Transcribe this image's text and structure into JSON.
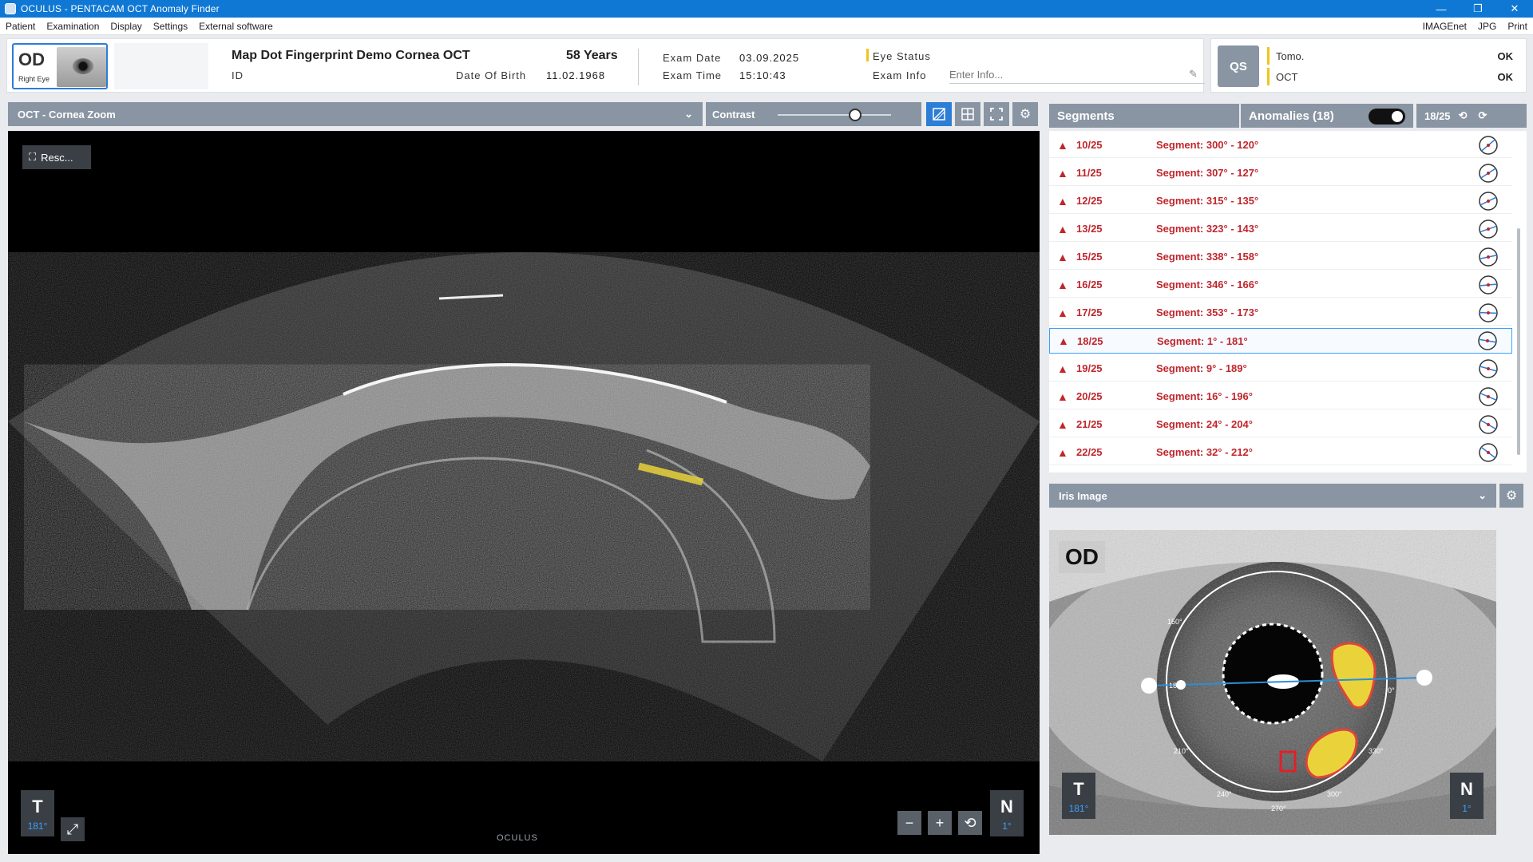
{
  "window": {
    "title": "OCULUS  -  PENTACAM   OCT Anomaly Finder",
    "minimize": "—",
    "maximize": "❐",
    "close": "✕"
  },
  "menu": {
    "left": [
      "Patient",
      "Examination",
      "Display",
      "Settings",
      "External software"
    ],
    "right": [
      "IMAGEnet",
      "JPG",
      "Print"
    ]
  },
  "patient": {
    "eye_code": "OD",
    "eye_label": "Right Eye",
    "name": "Map Dot Fingerprint Demo Cornea OCT",
    "age": "58 Years",
    "id_label": "ID",
    "dob_label": "Date Of Birth",
    "dob": "11.02.1968",
    "exam_date_label": "Exam Date",
    "exam_date": "03.09.2025",
    "exam_time_label": "Exam Time",
    "exam_time": "15:10:43",
    "eye_status_label": "Eye Status",
    "exam_info_label": "Exam Info",
    "exam_info_placeholder": "Enter Info..."
  },
  "qs": {
    "button": "QS",
    "rows": [
      {
        "name": "Tomo.",
        "value": "OK"
      },
      {
        "name": "OCT",
        "value": "OK"
      }
    ]
  },
  "oct": {
    "view_select": "OCT - Cornea Zoom",
    "contrast_label": "Contrast",
    "contrast_level": 0.68,
    "rescale_label": "Resc...",
    "left_dir": "T",
    "left_deg": "181°",
    "right_dir": "N",
    "right_deg": "1°",
    "logo": "OCULUS"
  },
  "segments": {
    "tab_label": "Segments",
    "anomalies_label": "Anomalies (18)",
    "anomalies_toggle": true,
    "counter": "18/25",
    "rows": [
      {
        "idx": "10/25",
        "label": "Segment: 300° - 120°"
      },
      {
        "idx": "11/25",
        "label": "Segment: 307° - 127°"
      },
      {
        "idx": "12/25",
        "label": "Segment: 315° - 135°"
      },
      {
        "idx": "13/25",
        "label": "Segment: 323° - 143°"
      },
      {
        "idx": "15/25",
        "label": "Segment: 338° - 158°"
      },
      {
        "idx": "16/25",
        "label": "Segment: 346° - 166°"
      },
      {
        "idx": "17/25",
        "label": "Segment: 353° - 173°"
      },
      {
        "idx": "18/25",
        "label": "Segment: 1° - 181°"
      },
      {
        "idx": "19/25",
        "label": "Segment: 9° - 189°"
      },
      {
        "idx": "20/25",
        "label": "Segment: 16° - 196°"
      },
      {
        "idx": "21/25",
        "label": "Segment: 24° - 204°"
      },
      {
        "idx": "22/25",
        "label": "Segment: 32° - 212°"
      }
    ],
    "selected_idx": "18/25"
  },
  "iris": {
    "view_select": "Iris Image",
    "eye_code": "OD",
    "left_dir": "T",
    "left_deg": "181°",
    "right_dir": "N",
    "right_deg": "1°",
    "ticks": [
      "150°",
      "180°",
      "210°",
      "240°",
      "270°",
      "300°",
      "330°",
      "0°"
    ]
  },
  "colors": {
    "accent": "#2b7dd6",
    "warning": "#c0262d",
    "status": "#f0c419",
    "bar": "#8a95a3"
  }
}
